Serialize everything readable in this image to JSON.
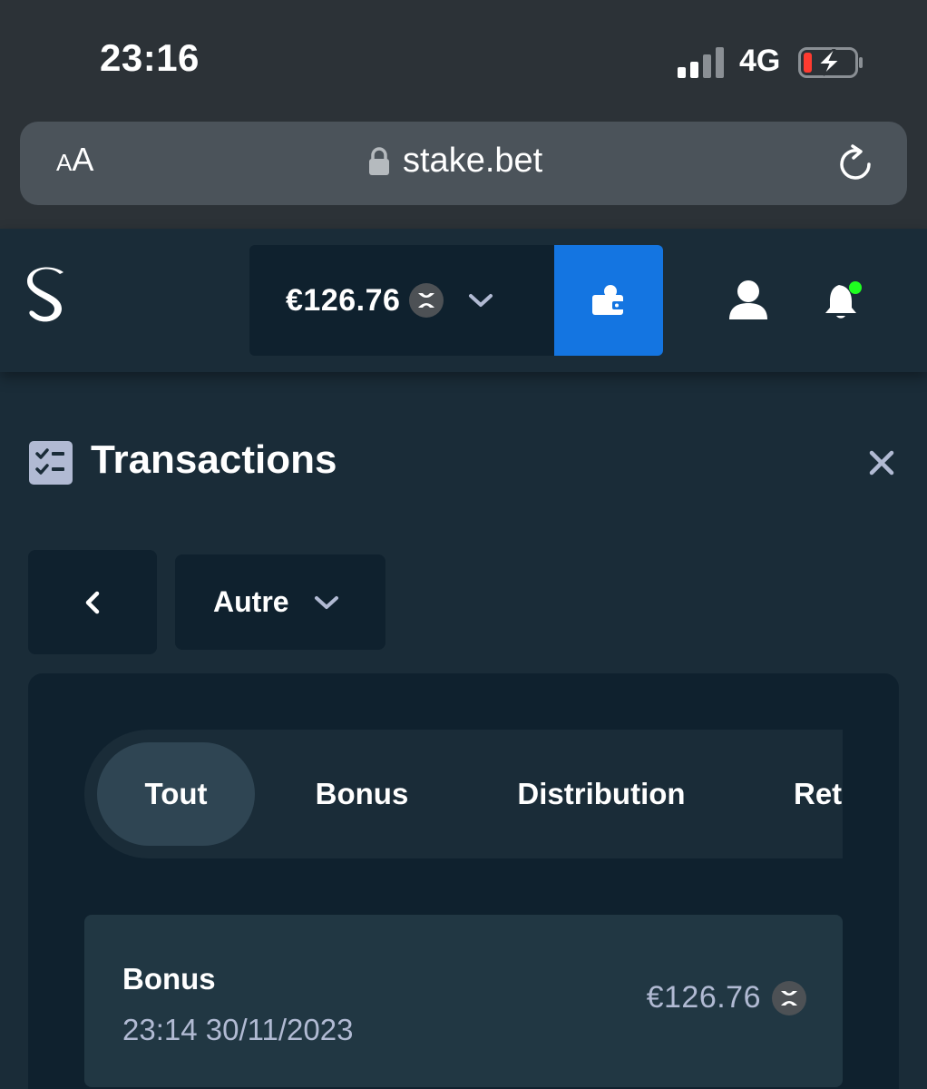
{
  "status_bar": {
    "time": "23:16",
    "network": "4G"
  },
  "browser": {
    "text_size_large": "A",
    "text_size_small": "A",
    "url": "stake.bet",
    "lock_icon": "lock-icon",
    "reload_icon": "reload-icon"
  },
  "header": {
    "logo_icon": "stake-logo",
    "balance": "€126.76",
    "currency_icon": "xrp-coin-icon",
    "wallet_icon": "wallet-icon",
    "user_icon": "user-icon",
    "notification_icon": "bell-icon",
    "colors": {
      "wallet_button": "#1475e1",
      "notification_dot": "#1fff20"
    }
  },
  "page": {
    "title": "Transactions",
    "title_icon": "checklist-icon",
    "close_icon": "close-icon"
  },
  "filters": {
    "back_icon": "chevron-left-icon",
    "selected_type": "Autre"
  },
  "tabs": [
    {
      "label": "Tout",
      "active": true
    },
    {
      "label": "Bonus",
      "active": false
    },
    {
      "label": "Distribution",
      "active": false
    },
    {
      "label": "Retrait",
      "active": false
    }
  ],
  "transactions": [
    {
      "title": "Bonus",
      "datetime": "23:14 30/11/2023",
      "amount": "€126.76"
    }
  ]
}
